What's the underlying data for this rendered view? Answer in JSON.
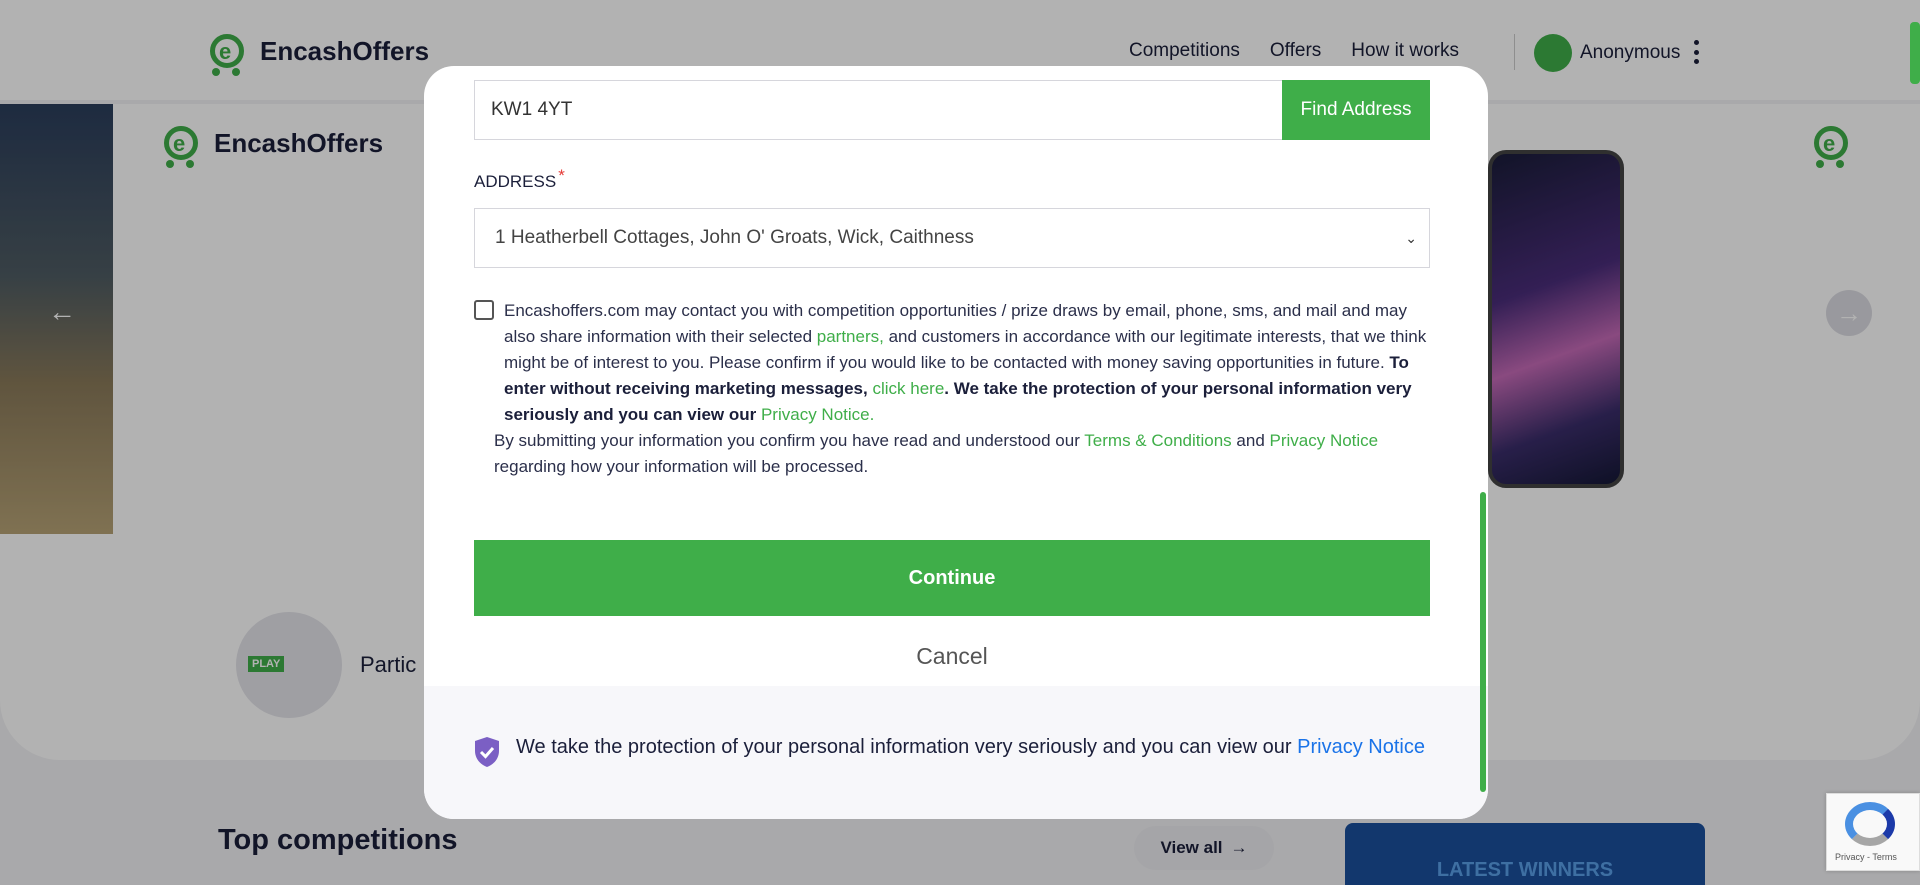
{
  "brand": {
    "name": "EncashOffers"
  },
  "nav": {
    "links": [
      "Competitions",
      "Offers",
      "How it works"
    ],
    "user_name": "Anonymous"
  },
  "hero": {
    "partial_text": "Partic",
    "play_badge": "PLAY"
  },
  "sections": {
    "top_competitions": "Top competitions",
    "view_all": "View all",
    "latest_winners": "LATEST WINNERS"
  },
  "modal": {
    "postcode_value": "KW1 4YT",
    "find_address_label": "Find Address",
    "address_label": "ADDRESS",
    "required_marker": "*",
    "address_selected": "1 Heatherbell Cottages, John O' Groats, Wick, Caithness",
    "consent": {
      "p1": "Encashoffers.com may contact you with competition opportunities / prize draws by email, phone, sms, and mail and may also share information with their selected ",
      "partners_link": "partners,",
      "p2": " and customers in accordance with our legitimate interests, that we think might be of interest to you. Please confirm if you would like to be contacted with money saving opportunities in future. ",
      "bold_text": "To enter without receiving marketing messages,",
      "click_here_link": "click here",
      "p3": ". We take the protection of your personal information very seriously and you can view our ",
      "privacy_notice_link": "Privacy Notice."
    },
    "submit_text": {
      "p1": "By submitting your information you confirm you have read and understood our ",
      "terms_link": "Terms & Conditions",
      "p2": " and ",
      "privacy_link": "Privacy Notice",
      "p3": " regarding how your information will be processed."
    },
    "continue_label": "Continue",
    "cancel_label": "Cancel",
    "footer_text": "We take the protection of your personal information very seriously and you can view our ",
    "footer_link": "Privacy Notice"
  },
  "recaptcha": {
    "text": "Privacy - Terms"
  },
  "colors": {
    "accent": "#3fae49",
    "navy": "#1b1f3a",
    "link_blue": "#1a73e8",
    "shield": "#7b5fc4"
  }
}
